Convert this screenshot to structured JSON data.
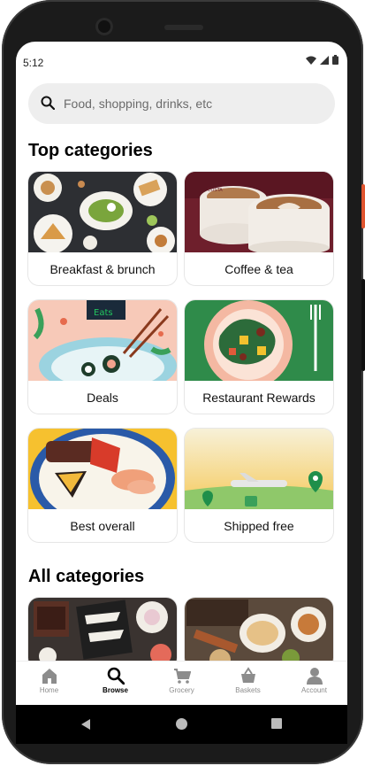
{
  "status_bar": {
    "time": "5:12"
  },
  "search": {
    "placeholder": "Food, shopping, drinks, etc"
  },
  "top_categories": {
    "title": "Top categories",
    "items": [
      {
        "label": "Breakfast & brunch"
      },
      {
        "label": "Coffee & tea"
      },
      {
        "label": "Deals"
      },
      {
        "label": "Restaurant Rewards"
      },
      {
        "label": "Best overall"
      },
      {
        "label": "Shipped free"
      }
    ]
  },
  "all_categories": {
    "title": "All categories"
  },
  "bottom_nav": {
    "items": [
      {
        "label": "Home",
        "icon": "home-icon"
      },
      {
        "label": "Browse",
        "icon": "search-icon",
        "active": true
      },
      {
        "label": "Grocery",
        "icon": "cart-icon"
      },
      {
        "label": "Baskets",
        "icon": "basket-icon"
      },
      {
        "label": "Account",
        "icon": "person-icon"
      }
    ]
  },
  "colors": {
    "accent_green": "#06a051",
    "brand_red": "#e0552f"
  }
}
